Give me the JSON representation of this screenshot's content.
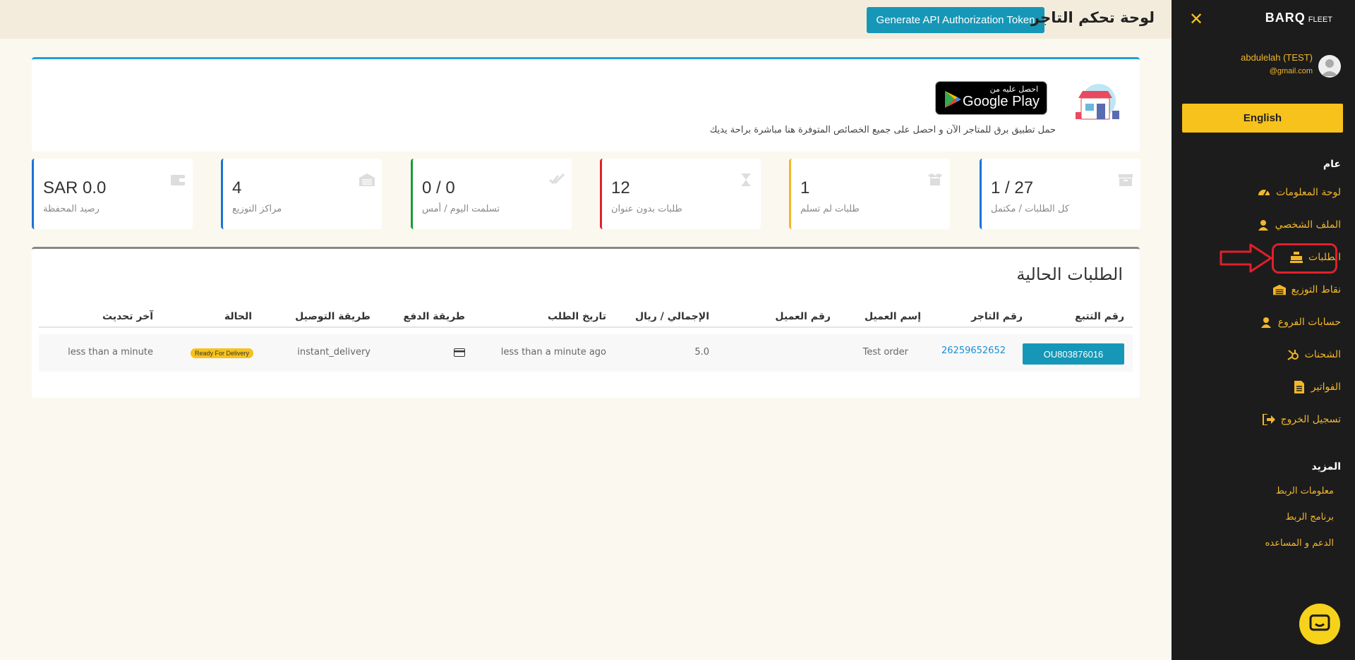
{
  "header": {
    "title": "لوحة تحكم التاجر",
    "api_button": "Generate API Authorization Token"
  },
  "banner": {
    "gplay_small": "احصل عليه من",
    "gplay_big": "Google Play",
    "text": "حمل تطبيق برق للمتاجر الآن و احصل على جميع الخصائص المتوفرة هنا مباشرة براحة يديك"
  },
  "stats": [
    {
      "value": "1 / 27",
      "label": "كل الطلبات / مكتمل",
      "color": "#1a73d9",
      "icon": "box-icon"
    },
    {
      "value": "1",
      "label": "طلبات لم تسلم",
      "color": "#f2b72a",
      "icon": "open-box-icon"
    },
    {
      "value": "12",
      "label": "طلبات بدون عنوان",
      "color": "#e0202a",
      "icon": "hourglass-icon"
    },
    {
      "value": "0 / 0",
      "label": "تسلمت اليوم / أمس",
      "color": "#1a9c3a",
      "icon": "double-check-icon"
    },
    {
      "value": "4",
      "label": "مراكز التوزيع",
      "color": "#1a73d9",
      "icon": "warehouse-icon"
    },
    {
      "value": "SAR 0.0",
      "label": "رصيد المحفظة",
      "color": "#1a73d9",
      "icon": "wallet-icon"
    }
  ],
  "orders": {
    "title": "الطلبات الحالية",
    "columns": [
      "رقم التتبع",
      "رقم التاجر",
      "إسم العميل",
      "رقم العميل",
      "الإجمالي / ريال",
      "تاريخ الطلب",
      "طريقة الدفع",
      "طريقة التوصيل",
      "الحالة",
      "آخر تحديث"
    ],
    "rows": [
      {
        "tracking": "OU803876016",
        "merchant_no": "26259652652",
        "customer_name": "Test order",
        "customer_no": "",
        "total": "5.0",
        "order_date": "less than a minute ago",
        "payment_icon": "card-icon",
        "delivery": "instant_delivery",
        "status": "Ready For Delivery",
        "updated": "less than a minute"
      }
    ]
  },
  "sidebar": {
    "brand": "BARQ",
    "brand_sub": "FLEET",
    "user_name": "abdulelah (TEST)",
    "user_email": "@gmail.com",
    "lang_button": "English",
    "general_heading": "عام",
    "items": [
      {
        "label": "لوحة المعلومات",
        "icon": "dashboard-icon"
      },
      {
        "label": "الملف الشخصي",
        "icon": "user-icon"
      },
      {
        "label": "الطلبات",
        "icon": "register-icon"
      },
      {
        "label": "نقاط التوزيع",
        "icon": "warehouse-icon"
      },
      {
        "label": "حسابات الفروع",
        "icon": "user-icon"
      },
      {
        "label": "الشحنات",
        "icon": "hubspot-icon"
      },
      {
        "label": "الفواتير",
        "icon": "invoice-icon"
      },
      {
        "label": "تسجيل الخروج",
        "icon": "logout-icon"
      }
    ],
    "more_heading": "المزيد",
    "more_links": [
      "معلومات الربط",
      "برنامج الربط",
      "الدعم و المساعده"
    ]
  },
  "colors": {
    "accent": "#1697b7",
    "brand_yellow": "#f7c21b",
    "sidebar_bg": "#1c1c1c",
    "highlight_red": "#e0202a"
  }
}
